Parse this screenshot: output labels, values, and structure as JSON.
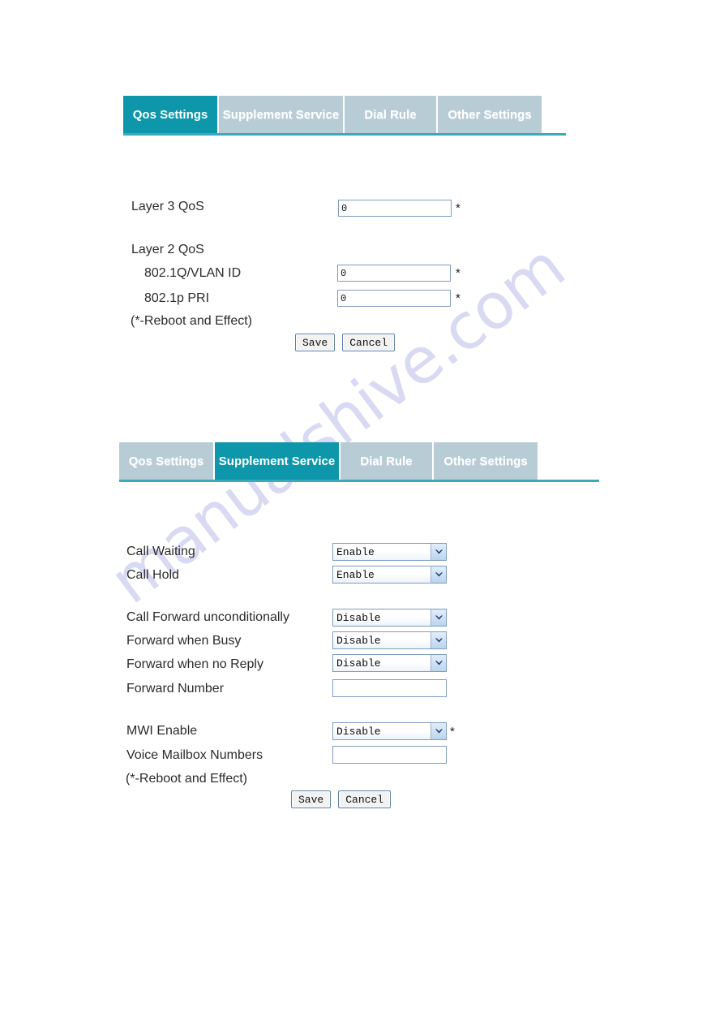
{
  "watermark": {
    "text": "manualshive.com"
  },
  "panels": [
    {
      "id": "qos",
      "tabs": [
        {
          "label": "Qos Settings",
          "active": true
        },
        {
          "label": "Supplement Service",
          "active": false
        },
        {
          "label": "Dial Rule",
          "active": false
        },
        {
          "label": "Other Settings",
          "active": false
        }
      ],
      "fields": [
        {
          "label": "Layer 3 QoS",
          "type": "text",
          "value": "0",
          "star": "*"
        },
        {
          "label": "Layer 2 QoS",
          "type": "heading"
        },
        {
          "label": "802.1Q/VLAN ID",
          "type": "text",
          "value": "0",
          "star": "*"
        },
        {
          "label": "802.1p PRI",
          "type": "text",
          "value": "0",
          "star": "*"
        }
      ],
      "note": "(*-Reboot and Effect)",
      "buttons": {
        "save": "Save",
        "cancel": "Cancel"
      }
    },
    {
      "id": "supplement",
      "tabs": [
        {
          "label": "Qos Settings",
          "active": false
        },
        {
          "label": "Supplement Service",
          "active": true
        },
        {
          "label": "Dial Rule",
          "active": false
        },
        {
          "label": "Other Settings",
          "active": false
        }
      ],
      "fields": [
        {
          "label": "Call Waiting",
          "type": "select",
          "value": "Enable",
          "star": ""
        },
        {
          "label": "Call Hold",
          "type": "select",
          "value": "Enable",
          "star": ""
        },
        {
          "label": "Call Forward unconditionally",
          "type": "select",
          "value": "Disable",
          "star": ""
        },
        {
          "label": "Forward when Busy",
          "type": "select",
          "value": "Disable",
          "star": ""
        },
        {
          "label": "Forward when no Reply",
          "type": "select",
          "value": "Disable",
          "star": ""
        },
        {
          "label": "Forward Number",
          "type": "text",
          "value": "",
          "star": ""
        },
        {
          "label": "MWI Enable",
          "type": "select",
          "value": "Disable",
          "star": "*"
        },
        {
          "label": "Voice Mailbox Numbers",
          "type": "text",
          "value": "",
          "star": ""
        }
      ],
      "note": "(*-Reboot and Effect)",
      "buttons": {
        "save": "Save",
        "cancel": "Cancel"
      }
    }
  ],
  "select_options": [
    "Enable",
    "Disable"
  ],
  "colors": {
    "tab_active": "#0e96aa",
    "tab_inactive": "#b8ccd6",
    "underline": "#3aa9ba",
    "watermark": "#b9bbe8",
    "field_border": "#7d9cc0"
  }
}
